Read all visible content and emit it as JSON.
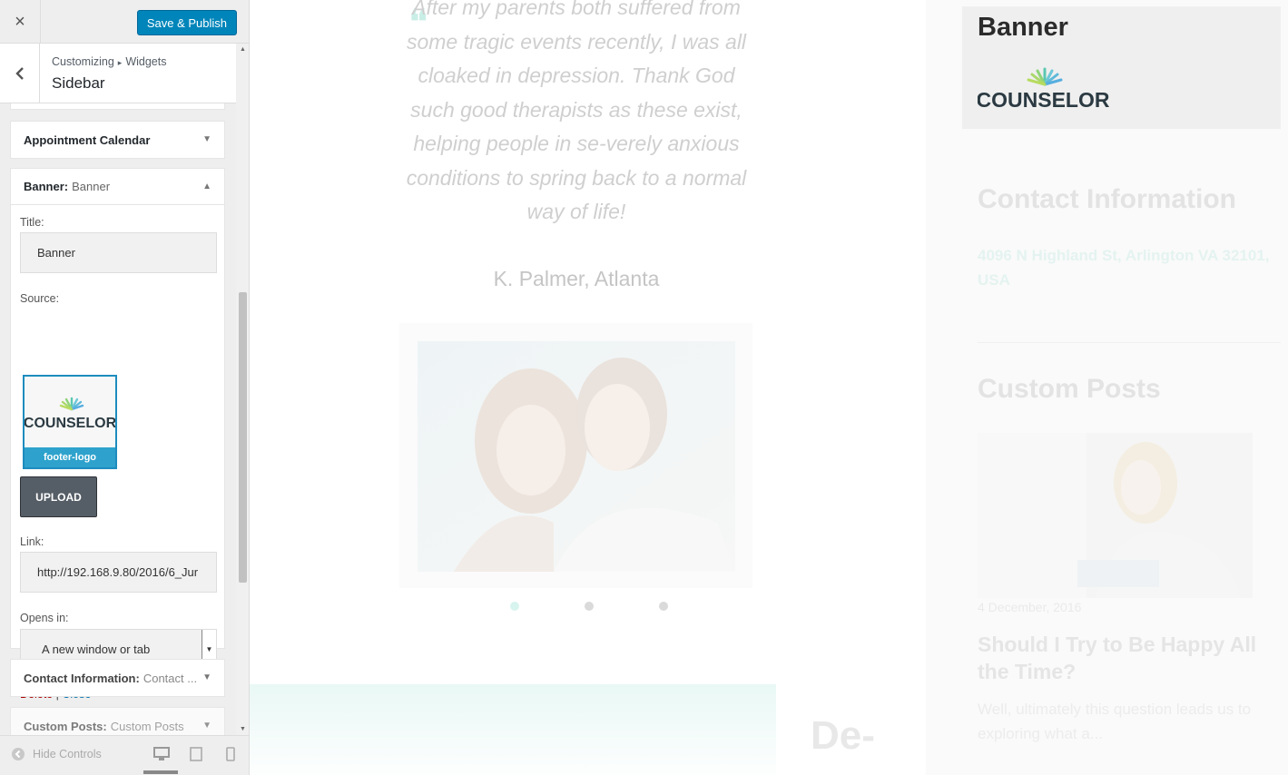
{
  "panel": {
    "close_icon": "×",
    "save_label": "Save & Publish",
    "back_icon": "chevron-left-icon",
    "breadcrumb": {
      "parent": "Customizing",
      "separator": "▸",
      "child": "Widgets"
    },
    "section_title": "Sidebar",
    "widgets": {
      "appointment": {
        "label": "Appointment Calendar"
      },
      "banner": {
        "label": "Banner:",
        "sub": "Banner",
        "title_label": "Title:",
        "title_value": "Banner",
        "source_label": "Source:",
        "image_caption": "footer-logo",
        "upload_label": "UPLOAD",
        "link_label": "Link:",
        "link_value": "http://192.168.9.80/2016/6_Jur",
        "opens_in_label": "Opens in:",
        "opens_in_value": "A new window or tab",
        "delete_label": "Delete",
        "separator": "|",
        "close_label": "Close"
      },
      "contact": {
        "label": "Contact Information:",
        "sub": "Contact ..."
      },
      "custom_posts": {
        "label": "Custom Posts:",
        "sub": "Custom Posts"
      }
    },
    "footer": {
      "hide_controls": "Hide Controls",
      "devices": [
        "desktop-icon",
        "tablet-icon",
        "mobile-icon"
      ]
    }
  },
  "preview": {
    "quote": "After my parents both suffered from some tragic events recently, I was all cloaked in depression. Thank God such good therapists as these exist, helping people in se-verely anxious conditions to spring back to a normal way of life!",
    "author": "K. Palmer, Atlanta",
    "band_text": "De-",
    "banner_title": "Banner",
    "logo_text": "COUNSELOR",
    "contact_title": "Contact Information",
    "contact_address": "4096 N Highland St, Arlington VA 32101, USA",
    "posts_title": "Custom Posts",
    "post_date": "4 December, 2016",
    "post_title": "Should I Try to Be Happy All the Time?",
    "post_excerpt": "Well, ultimately this question leads us to exploring what a..."
  },
  "colors": {
    "accent": "#0085ba",
    "brand_teal": "#5bc8b0",
    "brand_dark": "#2b3a42"
  }
}
